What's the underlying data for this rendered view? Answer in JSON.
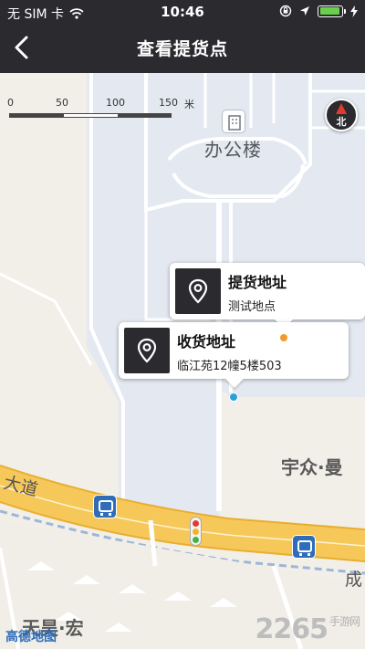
{
  "status_bar": {
    "carrier": "无 SIM 卡",
    "time": "10:46",
    "battery_level": 0.95
  },
  "nav": {
    "title": "查看提货点"
  },
  "map": {
    "scale": {
      "ticks": [
        "0",
        "50",
        "100",
        "150"
      ],
      "unit": "米"
    },
    "compass_label": "北",
    "office_label": "办公楼",
    "road_label": "大道",
    "right_poi_label": "宇众·曼",
    "bottom_poi_label": "天昊·宏",
    "bottom_right_road": "成",
    "pickup": {
      "title": "提货地址",
      "address": "测试地点",
      "dot_color": "#f39a2b"
    },
    "delivery": {
      "title": "收货地址",
      "address": "临江苑12幢5楼503",
      "dot_color": "#2aa0d8"
    }
  },
  "footer": {
    "map_provider": "高德地图",
    "watermark": "2265",
    "watermark_domain": "手游网"
  },
  "icons": [
    "back-arrow-icon",
    "wifi-icon",
    "lock-rotation-icon",
    "location-arrow-icon",
    "battery-icon",
    "compass-icon",
    "office-building-icon",
    "location-pin-icon",
    "bus-stop-icon",
    "traffic-light-icon"
  ]
}
